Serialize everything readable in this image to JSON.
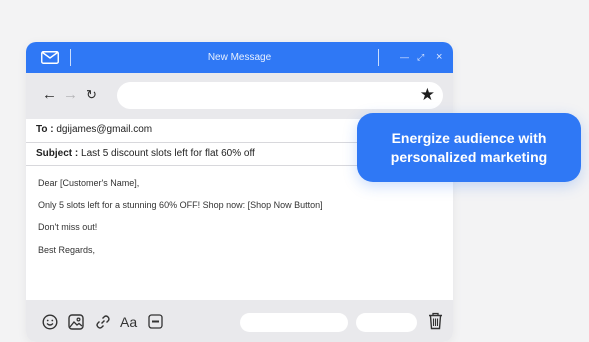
{
  "titlebar": {
    "title": "New Message",
    "minimize_label": "—",
    "expand_label": "⤢",
    "close_label": "×",
    "mail_icon": "mail-icon"
  },
  "browser": {
    "back_label": "←",
    "forward_label": "→",
    "reload_label": "↻",
    "star_label": "★",
    "url_value": ""
  },
  "email": {
    "to_label": "To :",
    "to_value": "dgijames@gmail.com",
    "subject_label": "Subject :",
    "subject_value": "Last 5 discount slots left for flat 60% off",
    "body": [
      "Dear [Customer's Name],",
      "Only 5 slots left for a stunning 60% OFF! Shop now: [Shop Now Button]",
      "Don't miss out!",
      "Best Regards,"
    ]
  },
  "footer": {
    "format_label": "Aa",
    "icons": [
      "emoji-icon",
      "image-icon",
      "link-icon",
      "format-icon",
      "gif-icon",
      "trash-icon"
    ]
  },
  "callout": {
    "line1": "Energize audience with",
    "line2": "personalized marketing"
  },
  "colors": {
    "accent": "#2f78f5",
    "bar": "#e9e9ec",
    "background": "#f3f3f4"
  }
}
